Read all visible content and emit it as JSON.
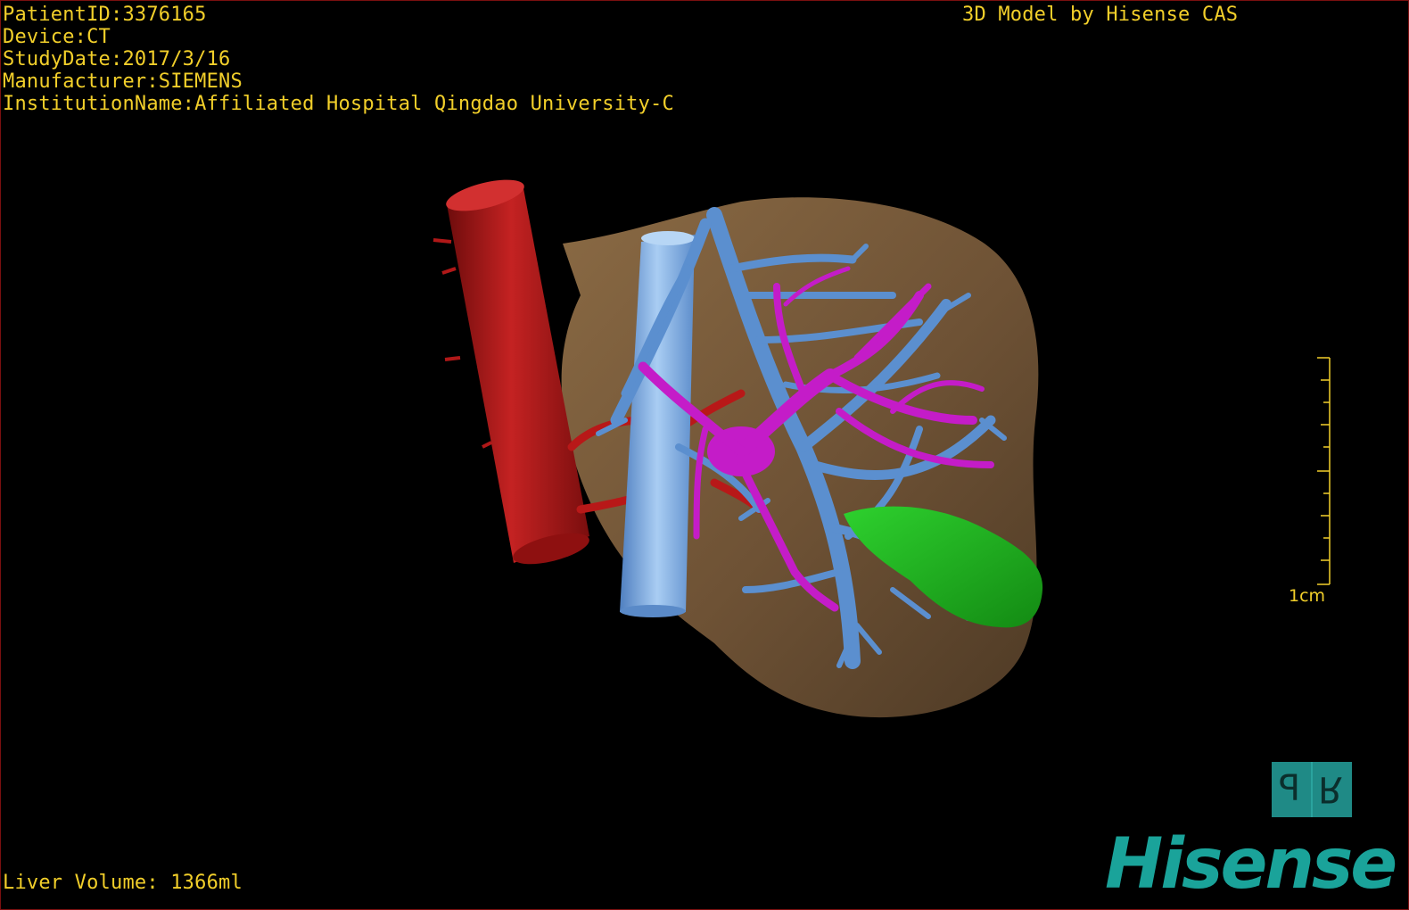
{
  "patient_info": {
    "patient_id": "PatientID:3376165",
    "device": "Device:CT",
    "study_date": "StudyDate:2017/3/16",
    "manufacturer": "Manufacturer:SIEMENS",
    "institution": "InstitutionName:Affiliated Hospital Qingdao University-C"
  },
  "model_credit": "3D Model by Hisense CAS",
  "liver_volume": "Liver Volume: 1366ml",
  "scale": {
    "label": "1cm"
  },
  "orientation_cube": {
    "left_letter": "P",
    "right_letter": "R"
  },
  "brand": {
    "logo_text": "Hisense"
  },
  "colors": {
    "overlay_text": "#f2cf2a",
    "liver": "#7a5c3a",
    "aorta": "#b01818",
    "ivc": "#6f9fd8",
    "hepatic_vein": "#5b8fcf",
    "portal_vein": "#c41cc8",
    "gallbladder": "#1fae1f",
    "brand": "#1aa39a"
  }
}
